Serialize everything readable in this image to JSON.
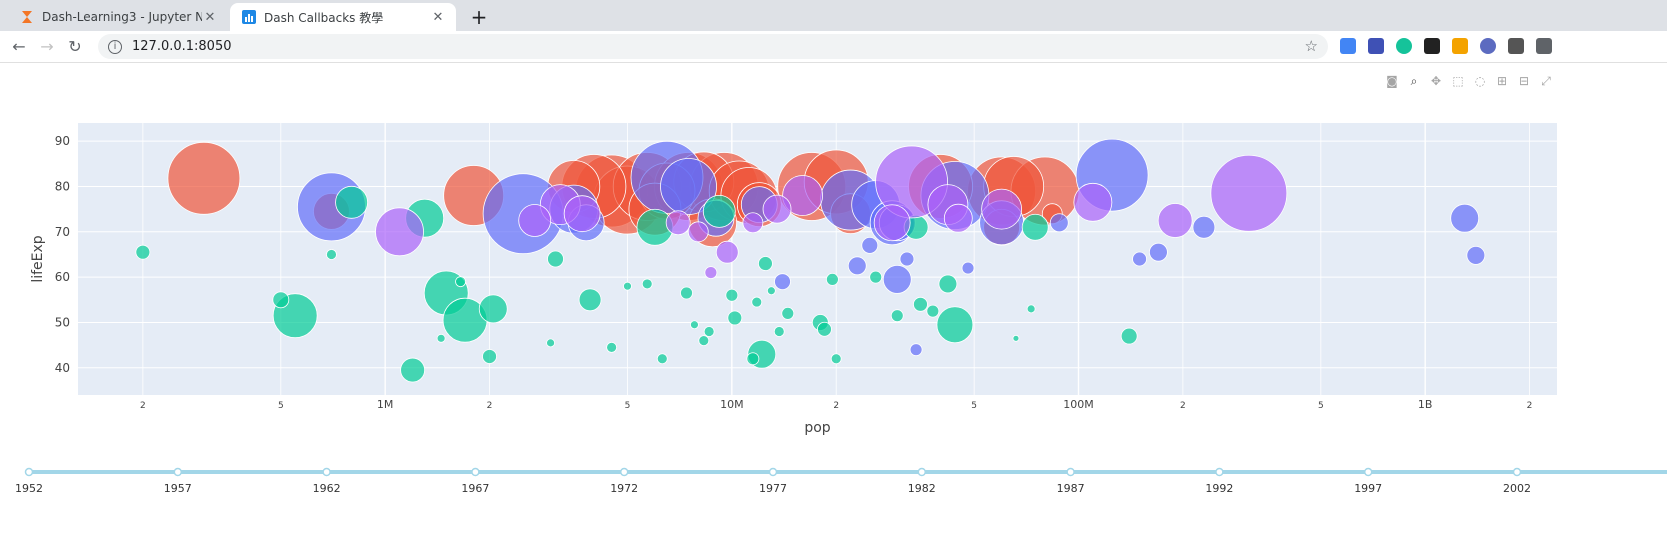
{
  "browser": {
    "tabs": [
      {
        "title": "Dash-Learning3 - Jupyter Notebook",
        "active": false,
        "icon": "hourglass-icon"
      },
      {
        "title": "Dash Callbacks 教學",
        "active": true,
        "icon": "chart-icon"
      }
    ],
    "url": "127.0.0.1:8050"
  },
  "colors": {
    "europe": "#ef553b",
    "asia": "#636efa",
    "africa": "#00cc96",
    "americas": "#ab63fa",
    "plot_bg": "#e5ecf6",
    "slider": "#a2d6e8"
  },
  "chart_data": {
    "type": "scatter",
    "xlabel": "pop",
    "ylabel": "lifeExp",
    "x_scale": "log",
    "xlim": [
      130000,
      2400000000
    ],
    "ylim": [
      34,
      94
    ],
    "y_ticks": [
      40,
      50,
      60,
      70,
      80,
      90
    ],
    "x_ticks": [
      {
        "v": 200000,
        "label": "2",
        "major": false
      },
      {
        "v": 500000,
        "label": "5",
        "major": false
      },
      {
        "v": 1000000,
        "label": "1M",
        "major": true
      },
      {
        "v": 2000000,
        "label": "2",
        "major": false
      },
      {
        "v": 5000000,
        "label": "5",
        "major": false
      },
      {
        "v": 10000000,
        "label": "10M",
        "major": true
      },
      {
        "v": 20000000,
        "label": "2",
        "major": false
      },
      {
        "v": 50000000,
        "label": "5",
        "major": false
      },
      {
        "v": 100000000,
        "label": "100M",
        "major": true
      },
      {
        "v": 200000000,
        "label": "2",
        "major": false
      },
      {
        "v": 500000000,
        "label": "5",
        "major": false
      },
      {
        "v": 1000000000,
        "label": "1B",
        "major": true
      },
      {
        "v": 2000000000,
        "label": "2",
        "major": false
      }
    ],
    "series": [
      {
        "key": "europe",
        "points": [
          [
            300000,
            81.8,
            36
          ],
          [
            700000,
            74.5,
            18
          ],
          [
            1800000,
            78,
            30
          ],
          [
            4000000,
            80,
            32
          ],
          [
            4500000,
            79,
            36
          ],
          [
            5000000,
            77,
            34
          ],
          [
            5700000,
            80,
            34
          ],
          [
            6500000,
            79,
            28
          ],
          [
            7500000,
            80,
            34
          ],
          [
            8300000,
            81,
            30
          ],
          [
            9500000,
            80,
            34
          ],
          [
            10500000,
            79,
            30
          ],
          [
            11200000,
            78,
            28
          ],
          [
            17000000,
            80,
            34
          ],
          [
            20000000,
            81,
            32
          ],
          [
            22000000,
            74,
            20
          ],
          [
            40000000,
            80,
            32
          ],
          [
            60000000,
            79,
            34
          ],
          [
            65000000,
            80,
            30
          ],
          [
            80000000,
            79,
            34
          ],
          [
            84000000,
            74,
            10
          ],
          [
            60000000,
            71,
            18
          ],
          [
            6000000,
            75,
            26
          ],
          [
            3500000,
            80,
            26
          ],
          [
            8800000,
            72,
            24
          ],
          [
            12000000,
            76,
            22
          ]
        ]
      },
      {
        "key": "asia",
        "points": [
          [
            700000,
            75.5,
            34
          ],
          [
            2500000,
            74,
            40
          ],
          [
            3500000,
            75,
            24
          ],
          [
            3800000,
            72,
            18
          ],
          [
            6500000,
            82,
            36
          ],
          [
            7500000,
            80,
            28
          ],
          [
            9000000,
            73,
            18
          ],
          [
            12000000,
            76,
            18
          ],
          [
            14000000,
            59,
            8
          ],
          [
            22000000,
            77,
            30
          ],
          [
            23000000,
            62.5,
            9
          ],
          [
            25000000,
            67,
            8
          ],
          [
            29000000,
            72,
            22
          ],
          [
            30000000,
            59.5,
            14
          ],
          [
            32000000,
            64,
            7
          ],
          [
            34000000,
            44,
            6
          ],
          [
            44000000,
            78,
            34
          ],
          [
            48000000,
            62,
            6
          ],
          [
            60000000,
            72,
            22
          ],
          [
            88000000,
            72,
            9
          ],
          [
            125000000,
            82.5,
            36
          ],
          [
            150000000,
            64,
            7
          ],
          [
            170000000,
            65.5,
            9
          ],
          [
            230000000,
            71,
            11
          ],
          [
            1400000000,
            64.8,
            9
          ],
          [
            1300000000,
            73,
            14
          ],
          [
            26000000,
            76,
            24
          ],
          [
            30000000,
            72,
            18
          ]
        ]
      },
      {
        "key": "africa",
        "points": [
          [
            200000,
            65.5,
            7
          ],
          [
            500000,
            55,
            8
          ],
          [
            550000,
            51.5,
            22
          ],
          [
            700000,
            65,
            5
          ],
          [
            800000,
            76.5,
            16
          ],
          [
            1200000,
            39.5,
            12
          ],
          [
            1300000,
            73,
            19
          ],
          [
            1450000,
            46.5,
            4
          ],
          [
            1500000,
            56.5,
            22
          ],
          [
            1650000,
            59,
            5
          ],
          [
            1700000,
            50.5,
            22
          ],
          [
            2000000,
            42.5,
            7
          ],
          [
            2050000,
            53,
            14
          ],
          [
            3000000,
            45.5,
            4
          ],
          [
            3100000,
            64,
            8
          ],
          [
            3900000,
            55,
            11
          ],
          [
            4500000,
            44.5,
            5
          ],
          [
            5000000,
            58,
            4
          ],
          [
            5700000,
            58.5,
            5
          ],
          [
            6000000,
            71,
            18
          ],
          [
            6300000,
            42,
            5
          ],
          [
            7400000,
            56.5,
            6
          ],
          [
            7800000,
            49.5,
            4
          ],
          [
            8300000,
            46,
            5
          ],
          [
            8600000,
            48,
            5
          ],
          [
            9200000,
            74.5,
            16
          ],
          [
            10000000,
            56,
            6
          ],
          [
            10200000,
            51,
            7
          ],
          [
            11500000,
            42,
            6
          ],
          [
            11800000,
            54.5,
            5
          ],
          [
            12200000,
            43,
            14
          ],
          [
            12500000,
            63,
            7
          ],
          [
            13000000,
            57,
            4
          ],
          [
            13700000,
            48,
            5
          ],
          [
            14500000,
            52,
            6
          ],
          [
            18000000,
            50,
            8
          ],
          [
            18500000,
            48.5,
            7
          ],
          [
            19500000,
            59.5,
            6
          ],
          [
            20000000,
            42,
            5
          ],
          [
            26000000,
            60,
            6
          ],
          [
            30000000,
            51.5,
            6
          ],
          [
            34000000,
            71,
            12
          ],
          [
            35000000,
            54,
            7
          ],
          [
            38000000,
            52.5,
            6
          ],
          [
            42000000,
            58.5,
            9
          ],
          [
            44000000,
            49.5,
            18
          ],
          [
            66000000,
            46.5,
            3
          ],
          [
            73000000,
            53,
            4
          ],
          [
            75000000,
            71,
            13
          ],
          [
            140000000,
            47,
            8
          ]
        ]
      },
      {
        "key": "americas",
        "points": [
          [
            1100000,
            70,
            24
          ],
          [
            2700000,
            72.5,
            16
          ],
          [
            3200000,
            76,
            20
          ],
          [
            3700000,
            74,
            18
          ],
          [
            8700000,
            61,
            6
          ],
          [
            9700000,
            65.5,
            11
          ],
          [
            11500000,
            72,
            10
          ],
          [
            13500000,
            75,
            14
          ],
          [
            16000000,
            78,
            20
          ],
          [
            29000000,
            72,
            18
          ],
          [
            33000000,
            81,
            36
          ],
          [
            42000000,
            76,
            20
          ],
          [
            45000000,
            73,
            14
          ],
          [
            60000000,
            75,
            20
          ],
          [
            110000000,
            76.5,
            19
          ],
          [
            190000000,
            72.5,
            17
          ],
          [
            310000000,
            78.5,
            38
          ],
          [
            7000000,
            72,
            12
          ],
          [
            8000000,
            70,
            10
          ]
        ]
      }
    ],
    "slider": {
      "marks": [
        "1952",
        "1957",
        "1962",
        "1967",
        "1972",
        "1977",
        "1982",
        "1987",
        "1992",
        "1997",
        "2002"
      ]
    }
  }
}
